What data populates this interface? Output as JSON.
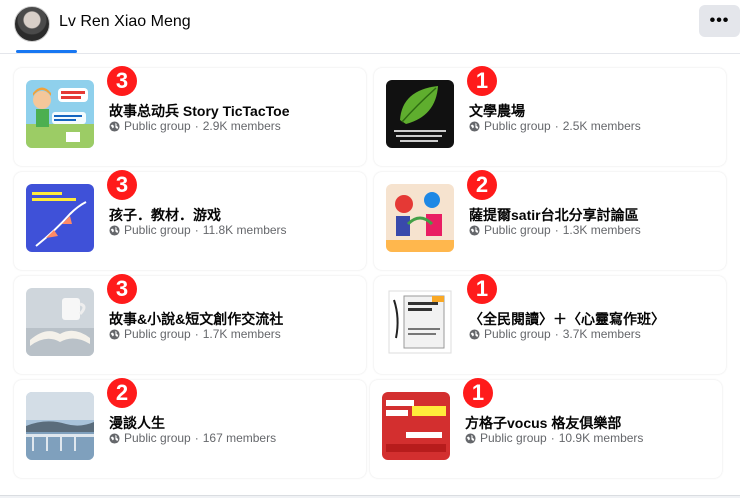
{
  "header": {
    "title": "Lv Ren Xiao Meng",
    "more_label": "•••"
  },
  "groups": [
    {
      "name": "故事总动兵 Story TicTacToe",
      "privacy": "Public group",
      "members": "2.9K members",
      "badge": "3"
    },
    {
      "name": "文學農場",
      "privacy": "Public group",
      "members": "2.5K members",
      "badge": "1"
    },
    {
      "name": "孩子．教材．游戏",
      "privacy": "Public group",
      "members": "11.8K members",
      "badge": "3"
    },
    {
      "name": "薩提爾satir台北分享討論區",
      "privacy": "Public group",
      "members": "1.3K members",
      "badge": "2"
    },
    {
      "name": "故事&小說&短文創作交流社",
      "privacy": "Public group",
      "members": "1.7K members",
      "badge": "3"
    },
    {
      "name": "〈全民閱讀〉＋〈心靈寫作班〉",
      "privacy": "Public group",
      "members": "3.7K members",
      "badge": "1"
    },
    {
      "name": "漫談人生",
      "privacy": "Public group",
      "members": "167 members",
      "badge": "2"
    },
    {
      "name": "方格子vocus 格友俱樂部",
      "privacy": "Public group",
      "members": "10.9K members",
      "badge": "1"
    }
  ],
  "colors": {
    "badge": "#ff1b1b",
    "accent": "#1877f2",
    "meta_text": "#65676b"
  },
  "icons": {
    "privacy": "globe-icon",
    "more": "more-options-icon"
  }
}
